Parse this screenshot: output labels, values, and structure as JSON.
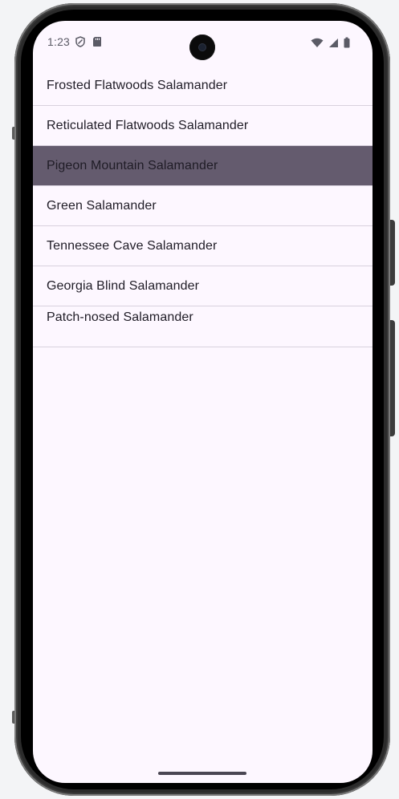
{
  "status_bar": {
    "time": "1:23"
  },
  "icons": {
    "left": [
      "shield-icon",
      "sd-card-icon"
    ],
    "right": [
      "wifi-icon",
      "signal-icon",
      "battery-icon"
    ]
  },
  "list": {
    "items": [
      {
        "label": "Frosted Flatwoods Salamander"
      },
      {
        "label": "Reticulated Flatwoods Salamander"
      },
      {
        "label": "Pigeon Mountain Salamander"
      },
      {
        "label": "Green Salamander"
      },
      {
        "label": "Tennessee Cave Salamander"
      },
      {
        "label": "Georgia Blind Salamander"
      },
      {
        "label": "Patch-nosed Salamander"
      }
    ]
  },
  "colors": {
    "screen_background": "#fdf7ff",
    "selected_row": "#645b6e",
    "divider": "#d8d1dd",
    "text": "#1f1c26"
  }
}
